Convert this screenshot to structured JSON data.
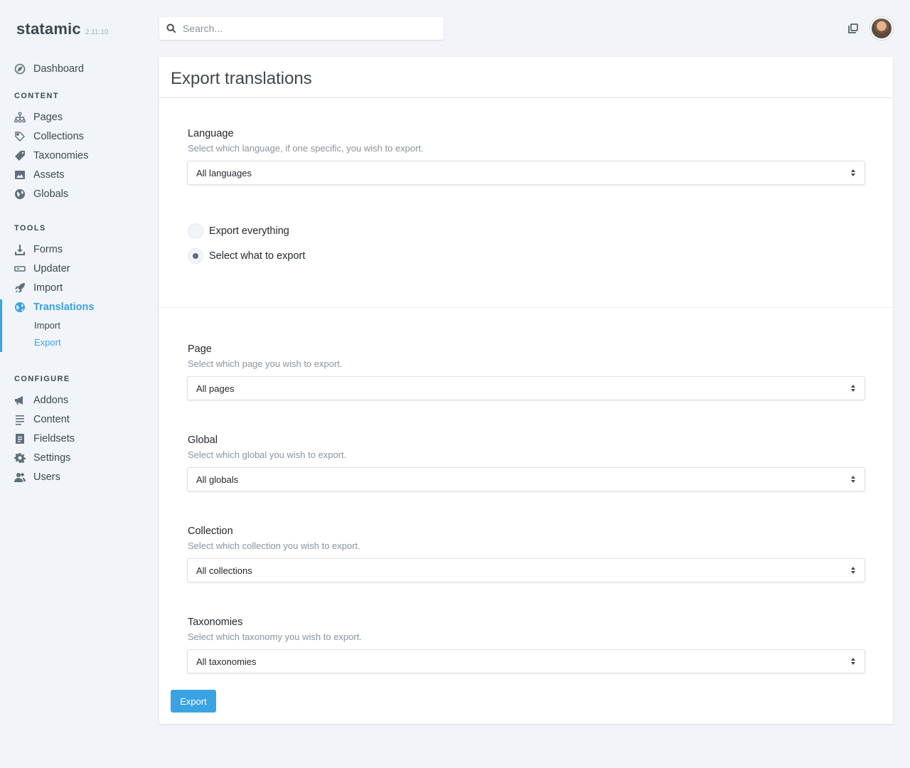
{
  "app": {
    "name": "statamic",
    "version": "2.11.10"
  },
  "search": {
    "placeholder": "Search..."
  },
  "sidebar": {
    "dashboard": {
      "label": "Dashboard",
      "icon": "compass-icon"
    },
    "sections": [
      {
        "title": "CONTENT",
        "items": [
          {
            "label": "Pages",
            "icon": "sitemap-icon"
          },
          {
            "label": "Collections",
            "icon": "tag-icon"
          },
          {
            "label": "Taxonomies",
            "icon": "tags-icon"
          },
          {
            "label": "Assets",
            "icon": "image-icon"
          },
          {
            "label": "Globals",
            "icon": "globe-icon"
          }
        ]
      },
      {
        "title": "TOOLS",
        "items": [
          {
            "label": "Forms",
            "icon": "download-icon"
          },
          {
            "label": "Updater",
            "icon": "cartridge-icon"
          },
          {
            "label": "Import",
            "icon": "rocket-icon"
          },
          {
            "label": "Translations",
            "icon": "world-icon",
            "active": true,
            "children": [
              {
                "label": "Import"
              },
              {
                "label": "Export",
                "active": true
              }
            ]
          }
        ]
      },
      {
        "title": "CONFIGURE",
        "items": [
          {
            "label": "Addons",
            "icon": "megaphone-icon"
          },
          {
            "label": "Content",
            "icon": "lines-icon"
          },
          {
            "label": "Fieldsets",
            "icon": "form-icon"
          },
          {
            "label": "Settings",
            "icon": "gear-icon"
          },
          {
            "label": "Users",
            "icon": "users-icon"
          }
        ]
      }
    ]
  },
  "page": {
    "title": "Export translations",
    "language": {
      "label": "Language",
      "help": "Select which language, if one specific, you wish to export.",
      "value": "All languages"
    },
    "mode": {
      "options": [
        "Export everything",
        "Select what to export"
      ],
      "selected": "Select what to export"
    },
    "fields": [
      {
        "label": "Page",
        "help": "Select which page you wish to export.",
        "value": "All pages"
      },
      {
        "label": "Global",
        "help": "Select which global you wish to export.",
        "value": "All globals"
      },
      {
        "label": "Collection",
        "help": "Select which collection you wish to export.",
        "value": "All collections"
      },
      {
        "label": "Taxonomies",
        "help": "Select which taxonomy you wish to export.",
        "value": "All taxonomies"
      }
    ],
    "submit_label": "Export"
  },
  "colors": {
    "accent": "#3aa3e3",
    "background": "#f1f4f8",
    "text": "#3d4852"
  }
}
